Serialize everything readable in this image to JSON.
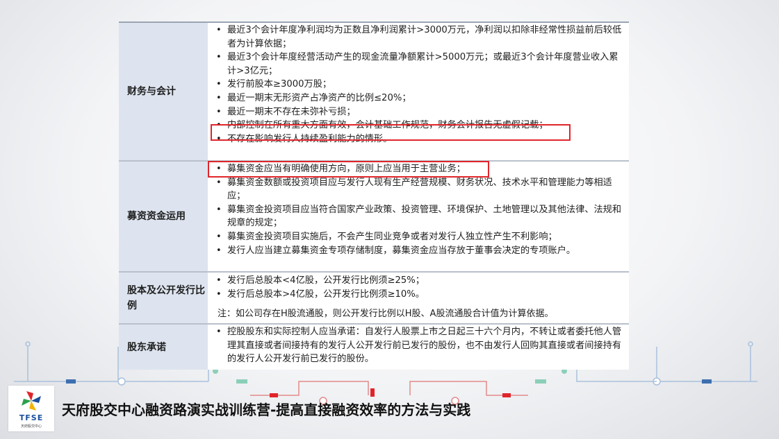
{
  "table": {
    "rows": [
      {
        "category": "财务与会计",
        "items": [
          "最近3个会计年度净利润均为正数且净利润累计>3000万元，净利润以扣除非经常性损益前后较低者为计算依据；",
          "最近3个会计年度经营活动产生的现金流量净额累计>5000万元；或最近3个会计年度营业收入累计>3亿元；",
          "发行前股本≥3000万股；",
          "最近一期末无形资产占净资产的比例≤20%；",
          "最近一期末不存在未弥补亏损；",
          "内部控制在所有重大方面有效，会计基础工作规范，财务会计报告无虚假记载；",
          "不存在影响发行人持续盈利能力的情形。"
        ]
      },
      {
        "category": "募资资金运用",
        "items": [
          "募集资金应当有明确使用方向，原则上应当用于主营业务；",
          "募集资金数额或投资项目应与发行人现有生产经营规模、财务状况、技术水平和管理能力等相适应；",
          "募集资金投资项目应当符合国家产业政策、投资管理、环境保护、土地管理以及其他法律、法规和规章的规定；",
          "募集资金投资项目实施后，不会产生同业竞争或者对发行人独立性产生不利影响；",
          "发行人应当建立募集资金专项存储制度，募集资金应当存放于董事会决定的专项账户。"
        ]
      },
      {
        "category": "股本及公开发行比例",
        "items": [
          "发行后总股本<4亿股，公开发行比例须≥25%；",
          "发行后总股本>4亿股，公开发行比例须≥10%。"
        ],
        "note": "注：如公司存在H股流通股，则公开发行比例以H股、A股流通股合计值为计算依据。"
      },
      {
        "category": "股东承诺",
        "items": [
          "控股股东和实际控制人应当承诺：自发行人股票上市之日起三十六个月内，不转让或者委托他人管理其直接或者间接持有的发行人公开发行前已发行的股份，也不由发行人回购其直接或者间接持有的发行人公开发行前已发行的股份。"
        ]
      }
    ]
  },
  "footer": {
    "logo_text": "TFSE",
    "logo_subtext": "天府股交中心",
    "title": "天府股交中心融资路演实战训练营-提高直接融资效率的方法与实践"
  },
  "colors": {
    "highlight": "#e0252a",
    "category_bg": "#dde4ef",
    "circuit_line": "#9bb8d6",
    "circuit_red": "#e0252a"
  }
}
